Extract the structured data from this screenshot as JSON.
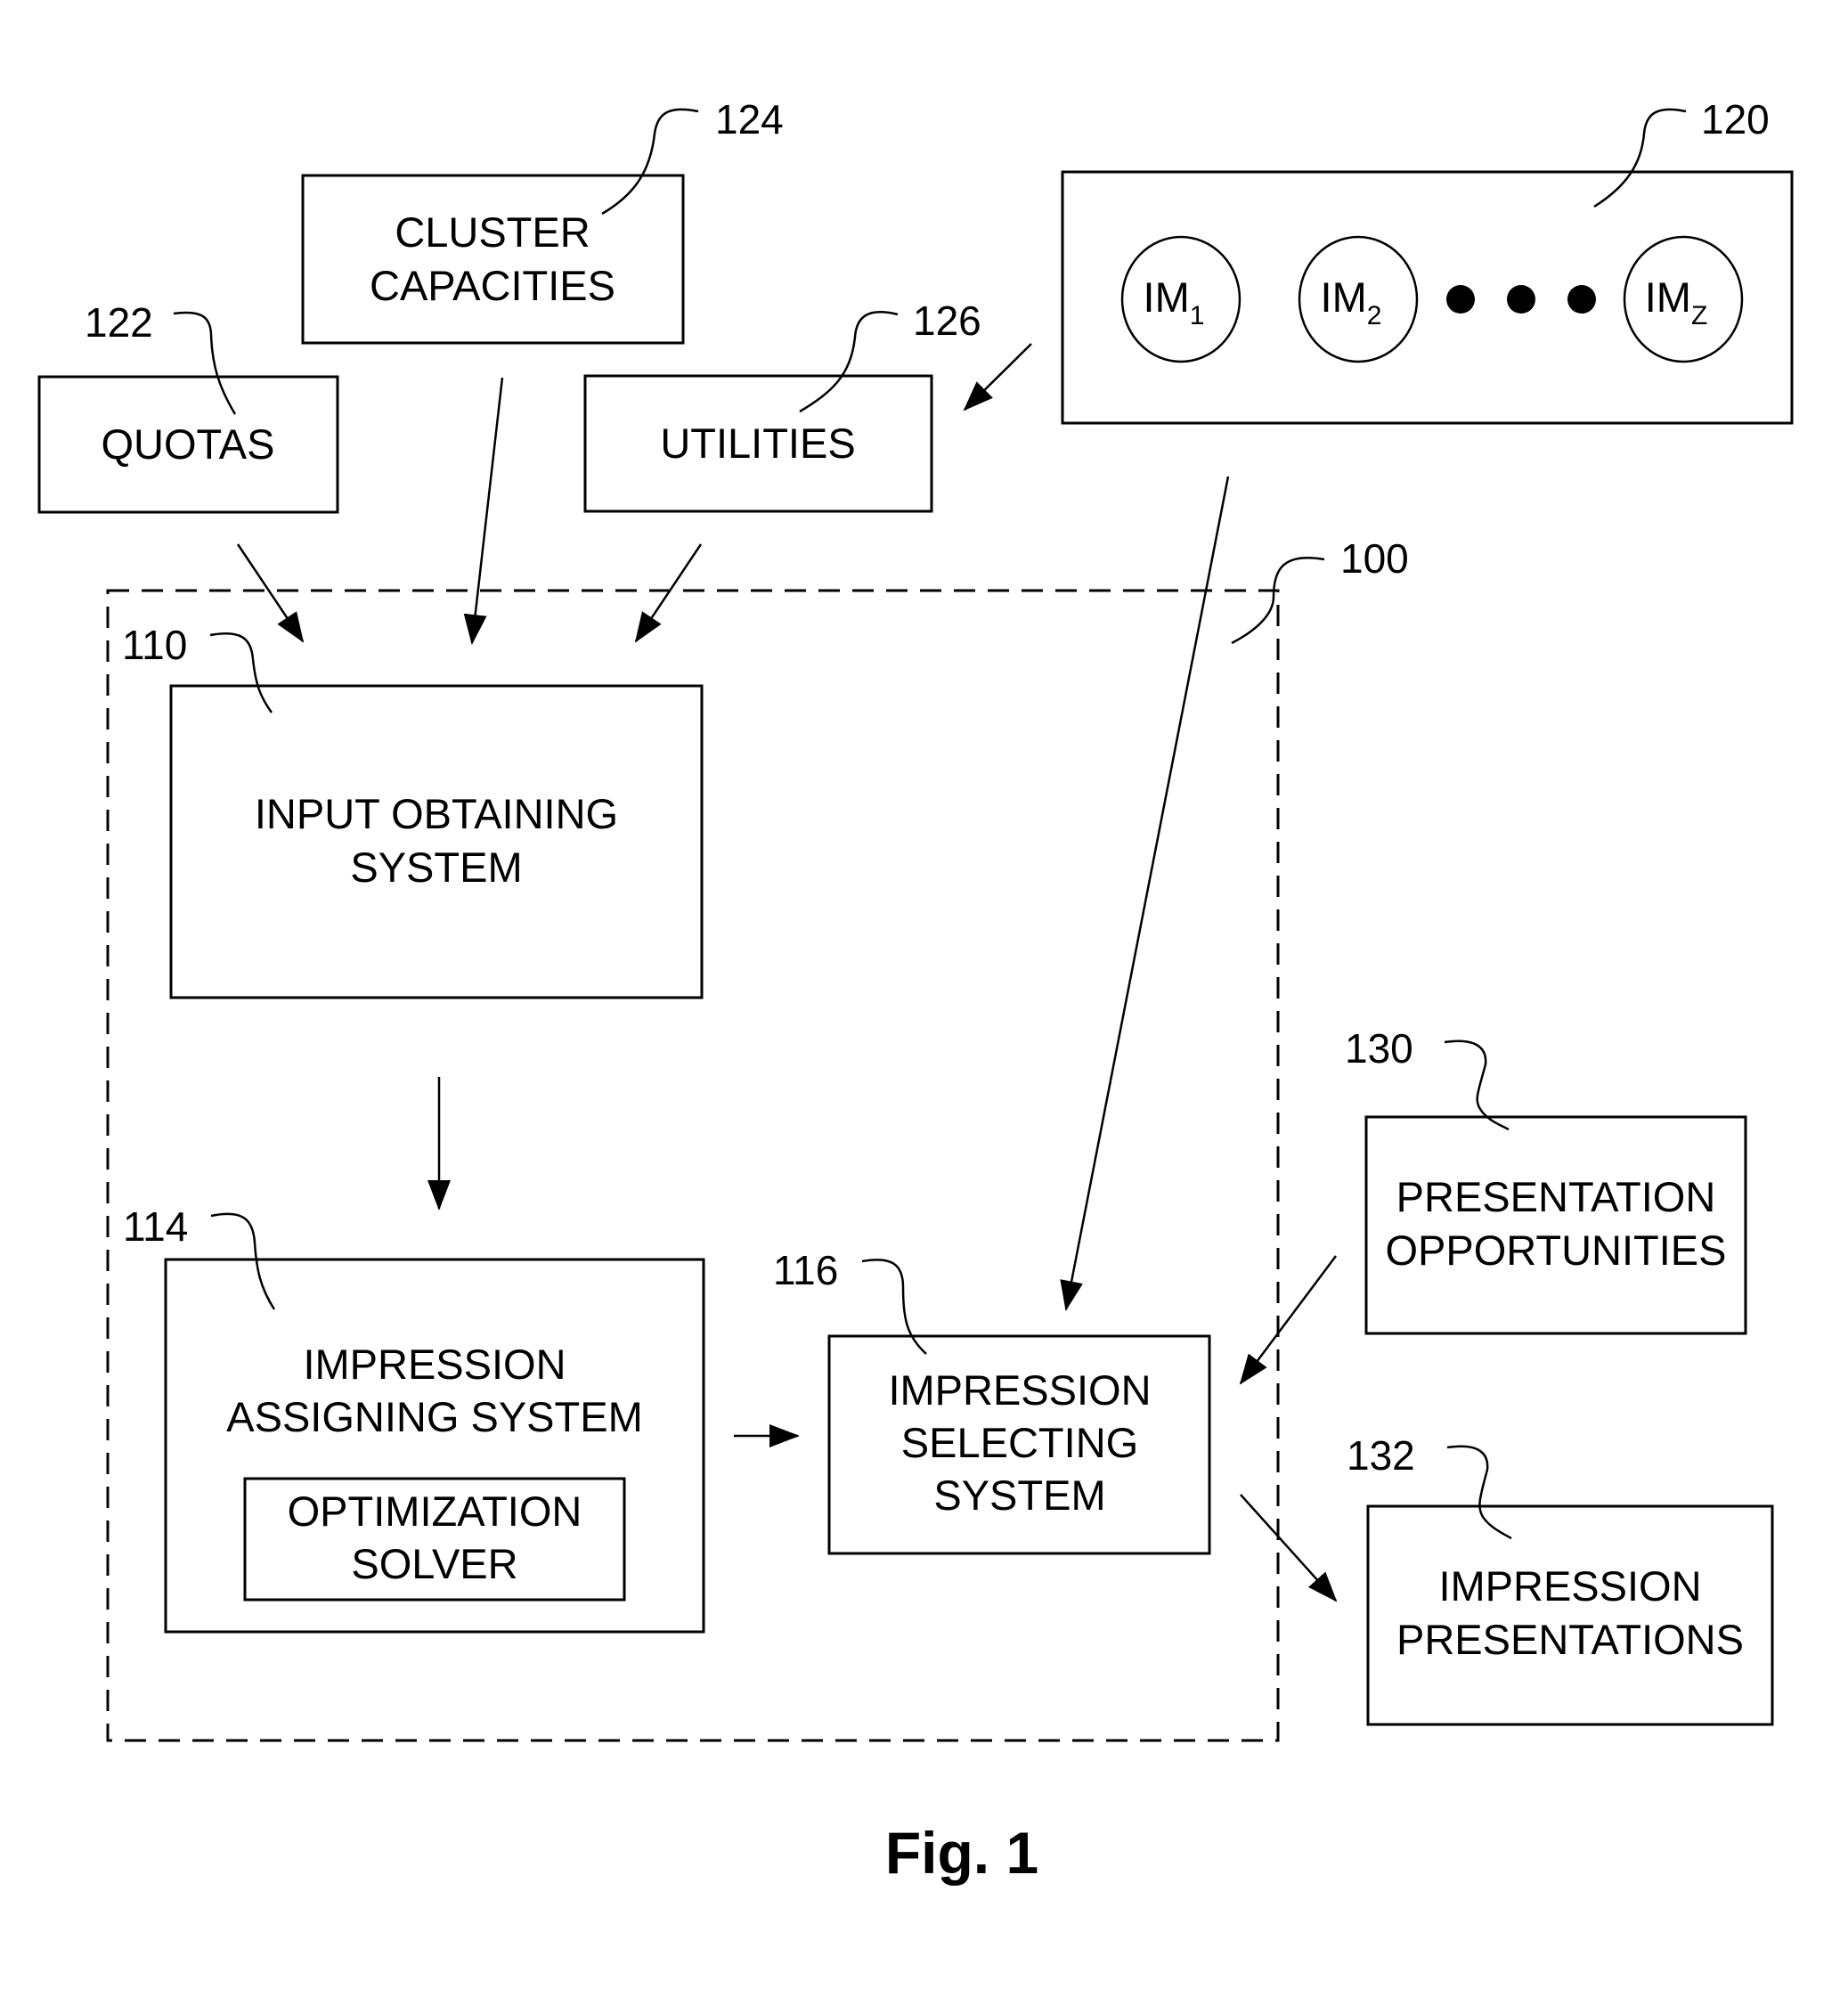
{
  "figure": {
    "caption": "Fig. 1",
    "system_ref": "100"
  },
  "inputs": {
    "quotas": {
      "ref": "122",
      "lines": [
        "QUOTAS"
      ]
    },
    "cluster_capacities": {
      "ref": "124",
      "lines": [
        "CLUSTER",
        "CAPACITIES"
      ]
    },
    "utilities": {
      "ref": "126",
      "lines": [
        "UTILITIES"
      ]
    },
    "impression_models": {
      "ref": "120",
      "items": [
        {
          "base": "IM",
          "sub": "1"
        },
        {
          "base": "IM",
          "sub": "2"
        },
        {
          "base": "IM",
          "sub": "Z"
        }
      ],
      "ellipsis": "●  ●  ●"
    }
  },
  "system": {
    "input_obtaining": {
      "ref": "110",
      "lines": [
        "INPUT OBTAINING",
        "SYSTEM"
      ]
    },
    "impression_assigning": {
      "ref": "114",
      "lines": [
        "IMPRESSION",
        "ASSIGNING SYSTEM"
      ]
    },
    "optimization_solver": {
      "lines": [
        "OPTIMIZATION",
        "SOLVER"
      ]
    },
    "impression_selecting": {
      "ref": "116",
      "lines": [
        "IMPRESSION",
        "SELECTING",
        "SYSTEM"
      ]
    }
  },
  "outputs": {
    "presentation_opportunities": {
      "ref": "130",
      "lines": [
        "PRESENTATION",
        "OPPORTUNITIES"
      ]
    },
    "impression_presentations": {
      "ref": "132",
      "lines": [
        "IMPRESSION",
        "PRESENTATIONS"
      ]
    }
  }
}
